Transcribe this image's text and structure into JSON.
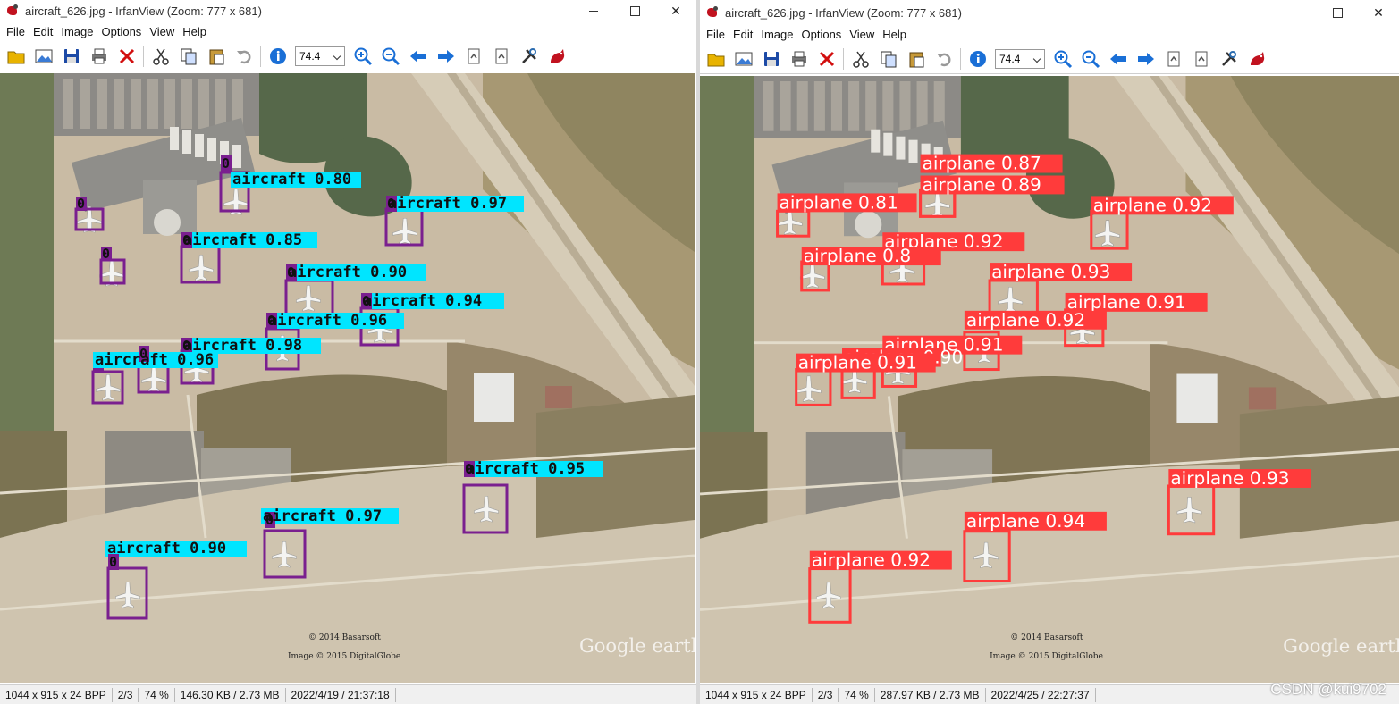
{
  "left": {
    "title": "aircraft_626.jpg - IrfanView (Zoom: 777 x 681)",
    "menu": [
      "File",
      "Edit",
      "Image",
      "Options",
      "View",
      "Help"
    ],
    "zoom": "74.4",
    "status": [
      "1044 x 915 x 24 BPP",
      "2/3",
      "74 %",
      "146.30 KB / 2.73 MB",
      "2022/4/19 / 21:37:18"
    ],
    "label_prefix": "0",
    "detections": [
      {
        "label": "aircraft 0.80"
      },
      {
        "label": "aircraft 0.97"
      },
      {
        "label": "aircraft 0.85"
      },
      {
        "label": "aircraft 0.90"
      },
      {
        "label": "aircraft 0.94"
      },
      {
        "label": "aircraft 0.96"
      },
      {
        "label": "aircraft 0.98"
      },
      {
        "label": "aircraft 0.96"
      },
      {
        "label": "aircraft 0.95"
      },
      {
        "label": "aircraft 0.97"
      },
      {
        "label": "aircraft 0.90"
      }
    ],
    "colors": {
      "box": "#7a1f8f",
      "label_bg": "#00e5ff",
      "label_text": "#111111"
    }
  },
  "right": {
    "title": "aircraft_626.jpg - IrfanView (Zoom: 777 x 681)",
    "menu": [
      "File",
      "Edit",
      "Image",
      "Options",
      "View",
      "Help"
    ],
    "zoom": "74.4",
    "status": [
      "1044 x 915 x 24 BPP",
      "2/3",
      "74 %",
      "287.97 KB / 2.73 MB",
      "2022/4/25 / 22:27:37"
    ],
    "detections": [
      {
        "label": "airplane 0.87"
      },
      {
        "label": "airplane 0.89"
      },
      {
        "label": "airplane 0.81"
      },
      {
        "label": "airplane 0.92"
      },
      {
        "label": "airplane 0.92"
      },
      {
        "label": "airplane 0.8"
      },
      {
        "label": "airplane 0.93"
      },
      {
        "label": "airplane 0.91"
      },
      {
        "label": "airplane 0.92"
      },
      {
        "label": "airplane 0.91"
      },
      {
        "label": "airplane 0.90"
      },
      {
        "label": "airplane 0.91"
      },
      {
        "label": "airplane 0.93"
      },
      {
        "label": "airplane 0.94"
      },
      {
        "label": "airplane 0.92"
      }
    ],
    "colors": {
      "box": "#ff3b3b",
      "label_bg": "#ff3b3b",
      "label_text": "#ffffff"
    }
  },
  "map_credits": [
    "© 2014 Basarsoft",
    "Image © 2015 DigitalGlobe"
  ],
  "map_logo": "Google earth",
  "watermark": "CSDN @kui9702"
}
